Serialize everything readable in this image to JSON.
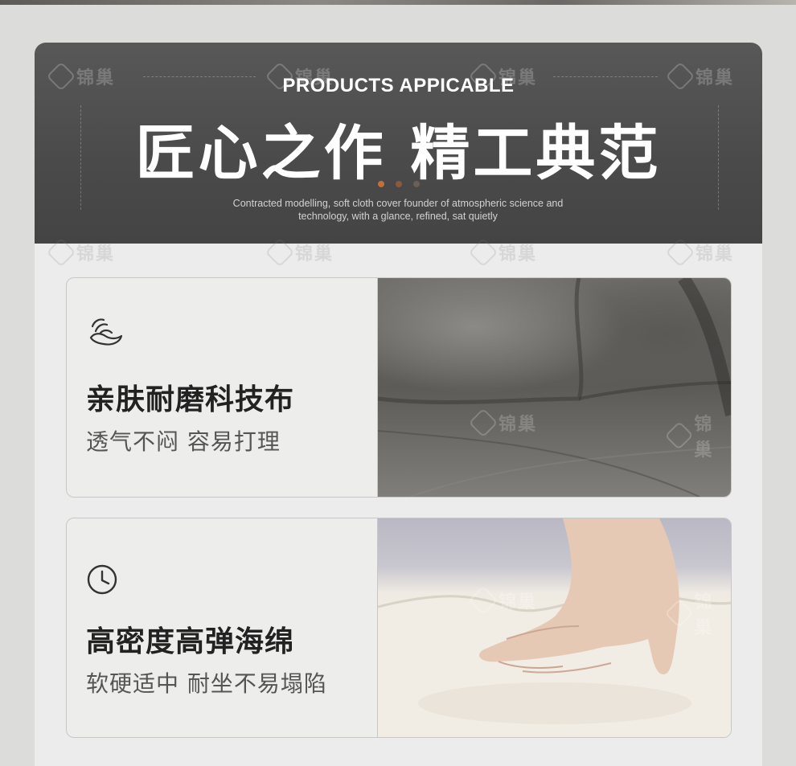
{
  "brand": {
    "watermark": "锦巢"
  },
  "hero": {
    "subtitle": "PRODUCTS APPICABLE",
    "title": "匠心之作 精工典范",
    "description_line1": "Contracted modelling, soft cloth cover founder of atmospheric science and",
    "description_line2": "technology, with a glance, refined, sat quietly"
  },
  "colors": {
    "dot_active": "#c0703a",
    "dot_mid": "#8a5a40",
    "dot_dim": "#6a5e58"
  },
  "features": [
    {
      "icon": "hand-wave-icon",
      "title": "亲肤耐磨科技布",
      "subtitle": "透气不闷 容易打理"
    },
    {
      "icon": "clock-icon",
      "title": "高密度高弹海绵",
      "subtitle": "软硬适中 耐坐不易塌陷"
    }
  ]
}
